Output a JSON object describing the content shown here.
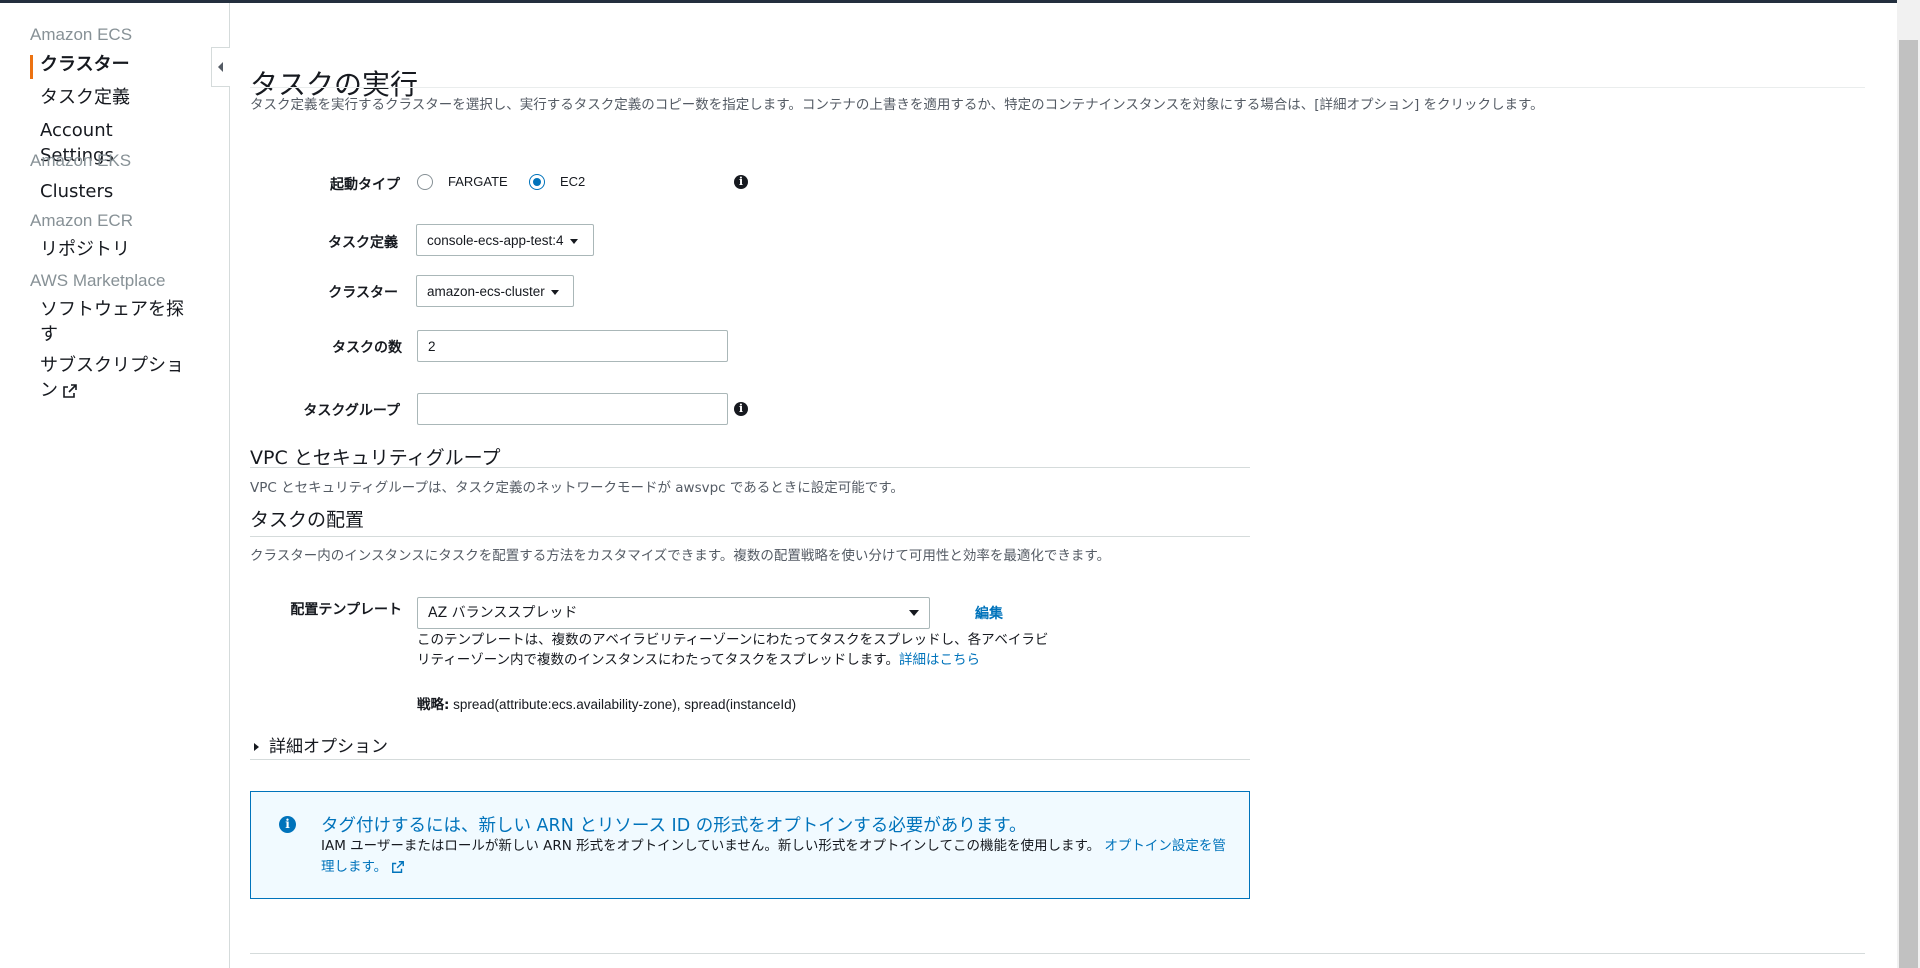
{
  "sidebar": {
    "groups": [
      {
        "title": "Amazon ECS",
        "items": [
          "クラスター",
          "タスク定義",
          "Account Settings"
        ]
      },
      {
        "title": "Amazon EKS",
        "items": [
          "Clusters"
        ]
      },
      {
        "title": "Amazon ECR",
        "items": [
          "リポジトリ"
        ]
      },
      {
        "title": "AWS Marketplace",
        "items": [
          "ソフトウェアを探す",
          "サブスクリプション"
        ]
      }
    ],
    "active_item": "クラスター"
  },
  "page": {
    "title": "タスクの実行",
    "description": "タスク定義を実行するクラスターを選択し、実行するタスク定義のコピー数を指定します。コンテナの上書きを適用するか、特定のコンテナインスタンスを対象にする場合は、[詳細オプション] をクリックします。"
  },
  "form": {
    "launch_type": {
      "label": "起動タイプ",
      "options": [
        "FARGATE",
        "EC2"
      ],
      "selected": "EC2"
    },
    "task_definition": {
      "label": "タスク定義",
      "value": "console-ecs-app-test:4"
    },
    "cluster": {
      "label": "クラスター",
      "value": "amazon-ecs-cluster"
    },
    "task_count": {
      "label": "タスクの数",
      "value": "2"
    },
    "task_group": {
      "label": "タスクグループ",
      "value": ""
    }
  },
  "vpc": {
    "title": "VPC とセキュリティグループ",
    "description": "VPC とセキュリティグループは、タスク定義のネットワークモードが awsvpc であるときに設定可能です。"
  },
  "placement": {
    "title": "タスクの配置",
    "description": "クラスター内のインスタンスにタスクを配置する方法をカスタマイズできます。複数の配置戦略を使い分けて可用性と効率を最適化できます。",
    "template_label": "配置テンプレート",
    "template_value": "AZ バランススプレッド",
    "edit_label": "編集",
    "template_desc": "このテンプレートは、複数のアベイラビリティーゾーンにわたってタスクをスプレッドし、各アベイラビリティーゾーン内で複数のインスタンスにわたってタスクをスプレッドします。",
    "learn_more": "詳細はこちら",
    "strategy_label": "戦略:",
    "strategy_value": "spread(attribute:ecs.availability-zone), spread(instanceId)"
  },
  "advanced": {
    "label": "詳細オプション"
  },
  "alert": {
    "title": "タグ付けするには、新しい ARN とリソース ID の形式をオプトインする必要があります。",
    "body": "IAM ユーザーまたはロールが新しい ARN 形式をオプトインしていません。新しい形式をオプトインしてこの機能を使用します。",
    "link": "オプトイン設定を管理します。"
  },
  "colors": {
    "accent": "#ec7211",
    "link": "#0073bb",
    "alert_bg": "#f1faff"
  }
}
